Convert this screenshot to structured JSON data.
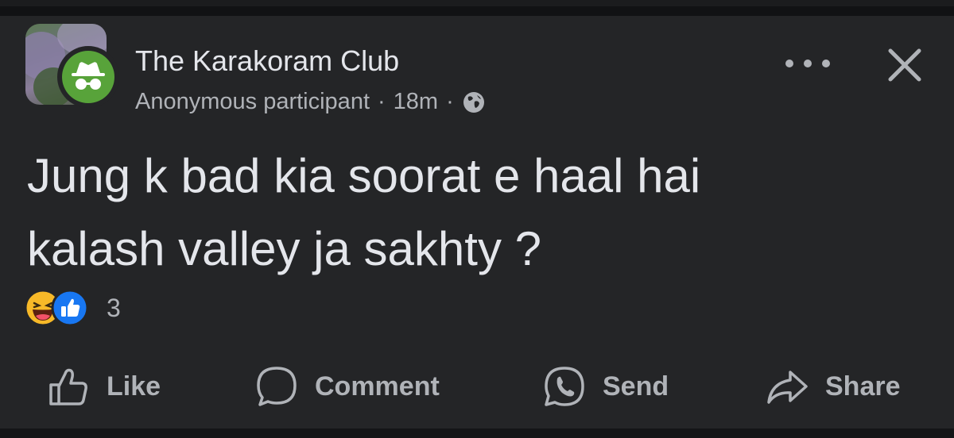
{
  "post": {
    "group_name": "The Karakoram Club",
    "author": "Anonymous participant",
    "dot": "·",
    "timestamp": "18m",
    "audience_icon": "globe-icon",
    "text": "Jung k bad kia soorat e haal hai\nkalash valley ja sakhty ?",
    "reactions": {
      "icons": [
        "haha-reaction-icon",
        "like-reaction-icon"
      ],
      "count": "3"
    }
  },
  "actions": {
    "like": "Like",
    "comment": "Comment",
    "send": "Send",
    "share": "Share"
  },
  "colors": {
    "background": "#242527",
    "primary_text": "#e4e6eb",
    "secondary_text": "#b0b3b8",
    "anon_badge": "#58a33a",
    "like_blue": "#1877f2"
  }
}
